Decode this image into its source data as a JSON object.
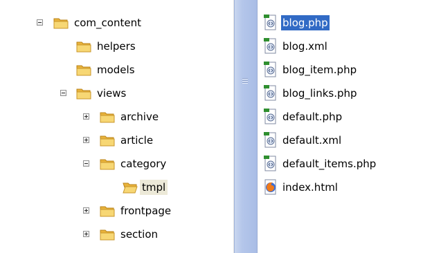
{
  "tree": {
    "items": [
      {
        "label": "com_content",
        "toggle": "minus",
        "open": true
      },
      {
        "label": "helpers",
        "toggle": "none",
        "open": false
      },
      {
        "label": "models",
        "toggle": "none",
        "open": false
      },
      {
        "label": "views",
        "toggle": "minus",
        "open": true
      },
      {
        "label": "archive",
        "toggle": "plus",
        "open": false
      },
      {
        "label": "article",
        "toggle": "plus",
        "open": false
      },
      {
        "label": "category",
        "toggle": "minus",
        "open": true
      },
      {
        "label": "tmpl",
        "toggle": "none",
        "open": true,
        "selected": true
      },
      {
        "label": "frontpage",
        "toggle": "plus",
        "open": false
      },
      {
        "label": "section",
        "toggle": "plus",
        "open": false
      }
    ]
  },
  "files": {
    "items": [
      {
        "label": "blog.php",
        "icon": "php-file-icon",
        "selected": true
      },
      {
        "label": "blog.xml",
        "icon": "xml-file-icon"
      },
      {
        "label": "blog_item.php",
        "icon": "php-file-icon"
      },
      {
        "label": "blog_links.php",
        "icon": "php-file-icon"
      },
      {
        "label": "default.php",
        "icon": "php-file-icon"
      },
      {
        "label": "default.xml",
        "icon": "xml-file-icon"
      },
      {
        "label": "default_items.php",
        "icon": "php-file-icon"
      },
      {
        "label": "index.html",
        "icon": "firefox-html-icon"
      }
    ]
  },
  "colors": {
    "folder": "#f2c94c",
    "selection_blue": "#316ac5",
    "tree_selection": "#ece9d8",
    "splitter": "#b4c6ea"
  }
}
